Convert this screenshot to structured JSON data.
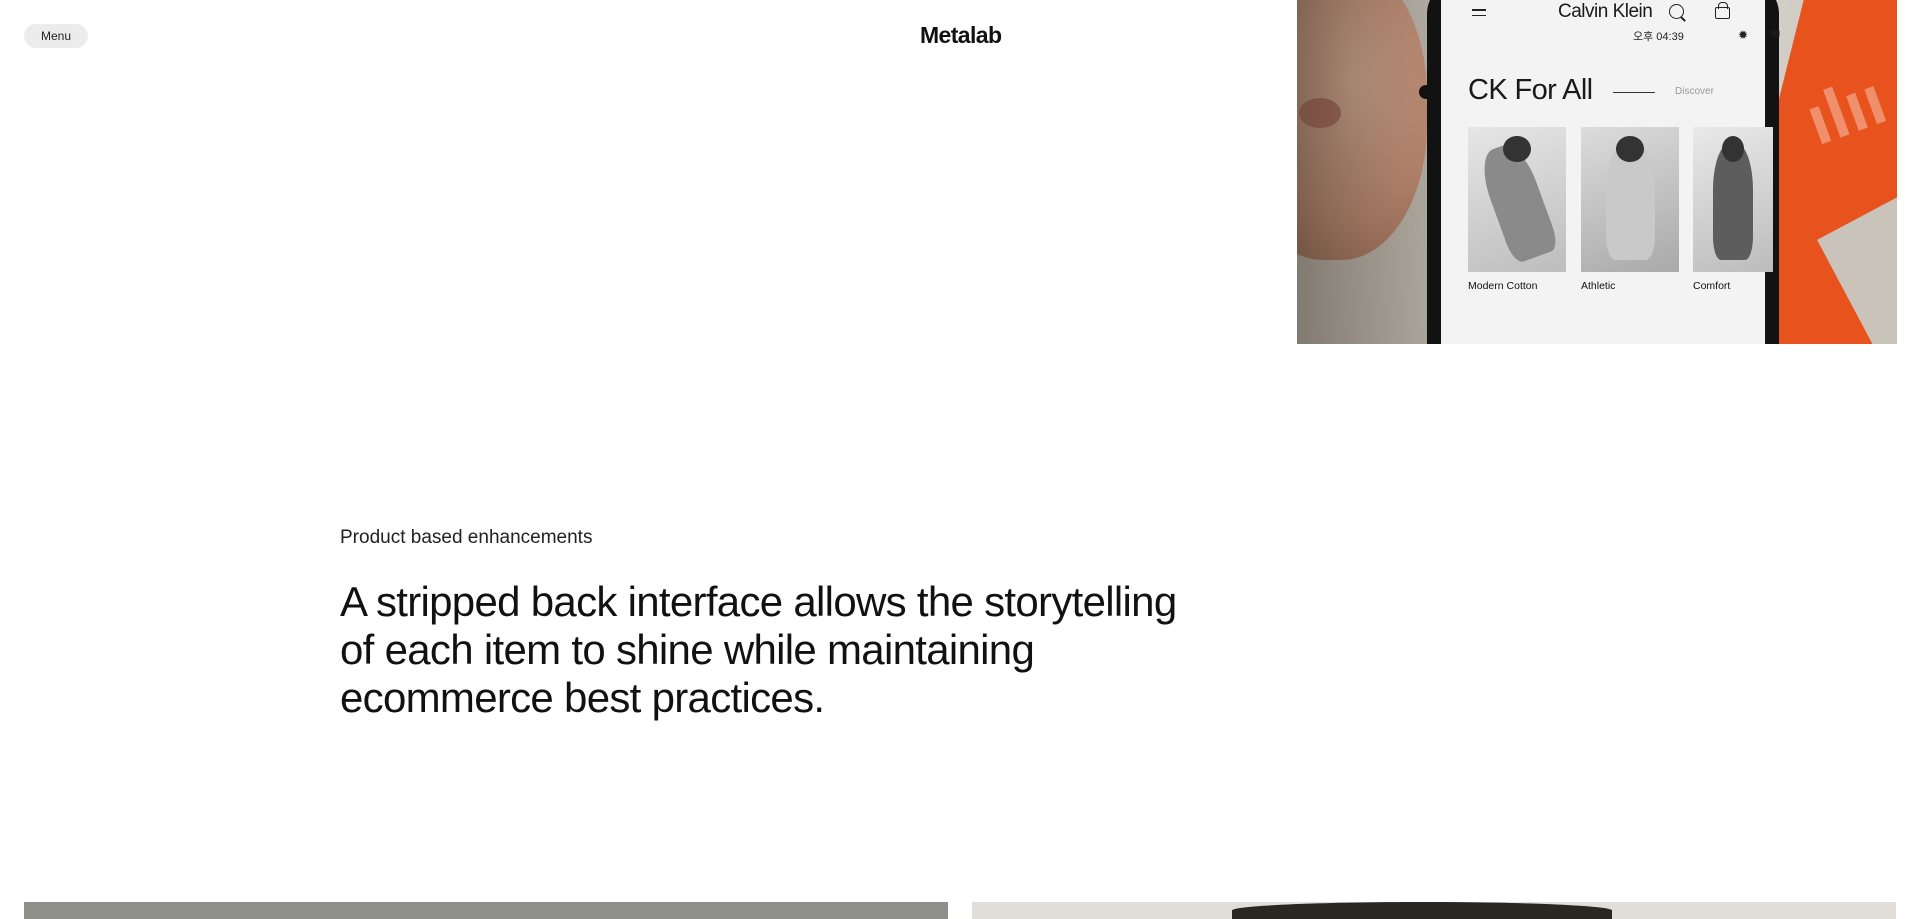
{
  "header": {
    "menu_label": "Menu",
    "brand": "Metalab"
  },
  "hero_phone": {
    "status_time": "오후 04:39",
    "logo": "Calvin Klein",
    "collection_title": "CK For All",
    "discover_label": "Discover",
    "products": [
      {
        "label": "Modern Cotton"
      },
      {
        "label": "Athletic"
      },
      {
        "label": "Comfort"
      }
    ]
  },
  "intro": {
    "eyebrow": "Product based enhancements",
    "headline": "A stripped back interface allows the storytelling of each item to shine while maintaining ecommerce best practices."
  },
  "colors": {
    "background": "#ffffff",
    "menu_pill": "#ececec",
    "accent_orange": "#e8531d"
  }
}
